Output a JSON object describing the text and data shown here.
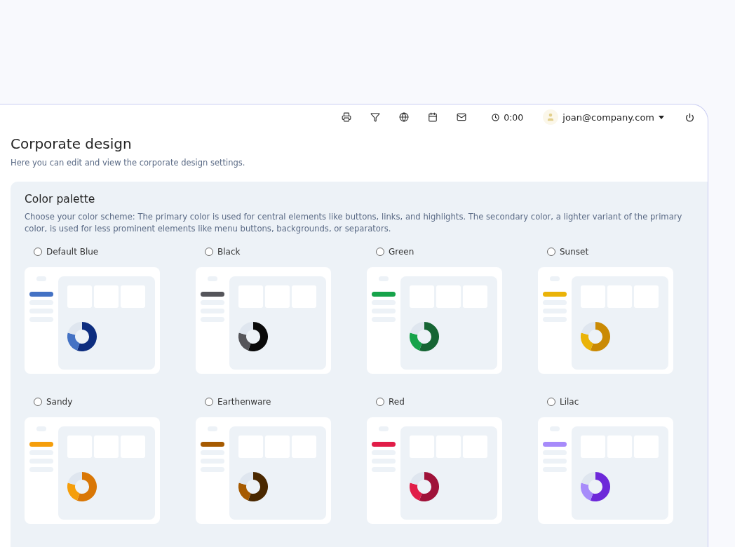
{
  "topbar": {
    "timer": "0:00",
    "user": "joan@company.com"
  },
  "page": {
    "title": "Corporate design",
    "subtitle": "Here you can edit and view the corporate design settings."
  },
  "palette_section": {
    "title": "Color palette",
    "description": "Choose your color scheme: The primary color is used for central elements like buttons, links, and highlights. The secondary color, a lighter variant of the primary color, is used for less prominent elements like menu buttons, backgrounds, or separators.",
    "options": [
      {
        "name": "Default Blue",
        "selected": false,
        "color": "#4472c4",
        "donut_segments": [
          {
            "color": "#0d2d7f"
          },
          {
            "color": "#4472c4"
          }
        ]
      },
      {
        "name": "Black",
        "selected": false,
        "color": "#55555a",
        "donut_segments": [
          {
            "color": "#0a0a0a"
          },
          {
            "color": "#55555a"
          }
        ]
      },
      {
        "name": "Green",
        "selected": false,
        "color": "#16a34a",
        "donut_segments": [
          {
            "color": "#166534"
          },
          {
            "color": "#16a34a"
          }
        ]
      },
      {
        "name": "Sunset",
        "selected": false,
        "color": "#eab308",
        "donut_segments": [
          {
            "color": "#ca8a04"
          },
          {
            "color": "#eab308"
          }
        ]
      },
      {
        "name": "Sandy",
        "selected": false,
        "color": "#f59e0b",
        "donut_segments": [
          {
            "color": "#d97706"
          },
          {
            "color": "#f59e0b"
          }
        ]
      },
      {
        "name": "Earthenware",
        "selected": false,
        "color": "#a65a00",
        "donut_segments": [
          {
            "color": "#4a2800"
          },
          {
            "color": "#a65a00"
          }
        ]
      },
      {
        "name": "Red",
        "selected": false,
        "color": "#e11d48",
        "donut_segments": [
          {
            "color": "#9f1239"
          },
          {
            "color": "#e11d48"
          }
        ]
      },
      {
        "name": "Lilac",
        "selected": false,
        "color": "#a78bfa",
        "donut_segments": [
          {
            "color": "#6d28d9"
          },
          {
            "color": "#a78bfa"
          }
        ]
      }
    ]
  }
}
